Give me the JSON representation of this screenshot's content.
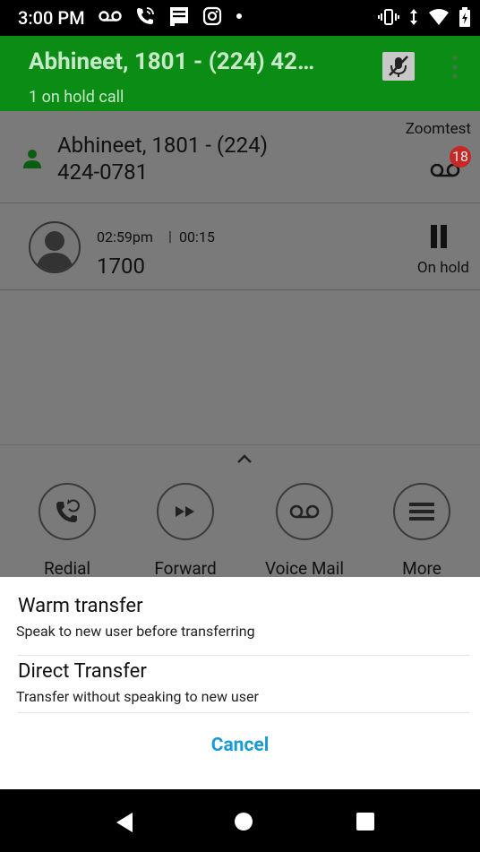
{
  "status_bar": {
    "time": "3:00 PM"
  },
  "header": {
    "title": "Abhineet, 1801 - (224) 42…",
    "subtitle": "1 on hold call"
  },
  "contact": {
    "name_line1": "Abhineet, 1801 - (224)",
    "name_line2": "424-0781",
    "account": "Zoomtest",
    "voicemail_count": "18"
  },
  "held_call": {
    "time": "02:59pm",
    "duration": "00:15",
    "number": "1700",
    "status": "On hold"
  },
  "actions": [
    {
      "label": "Redial"
    },
    {
      "label": "Forward"
    },
    {
      "label": "Voice Mail"
    },
    {
      "label": "More"
    }
  ],
  "transfer_sheet": {
    "options": [
      {
        "title": "Warm transfer",
        "subtitle": "Speak to new user before transferring"
      },
      {
        "title": "Direct Transfer",
        "subtitle": "Transfer without speaking to new user"
      }
    ],
    "cancel_label": "Cancel"
  },
  "colors": {
    "header_green": "#0b8c14",
    "accent_blue": "#1a9bd7",
    "badge_red": "#c62828"
  }
}
